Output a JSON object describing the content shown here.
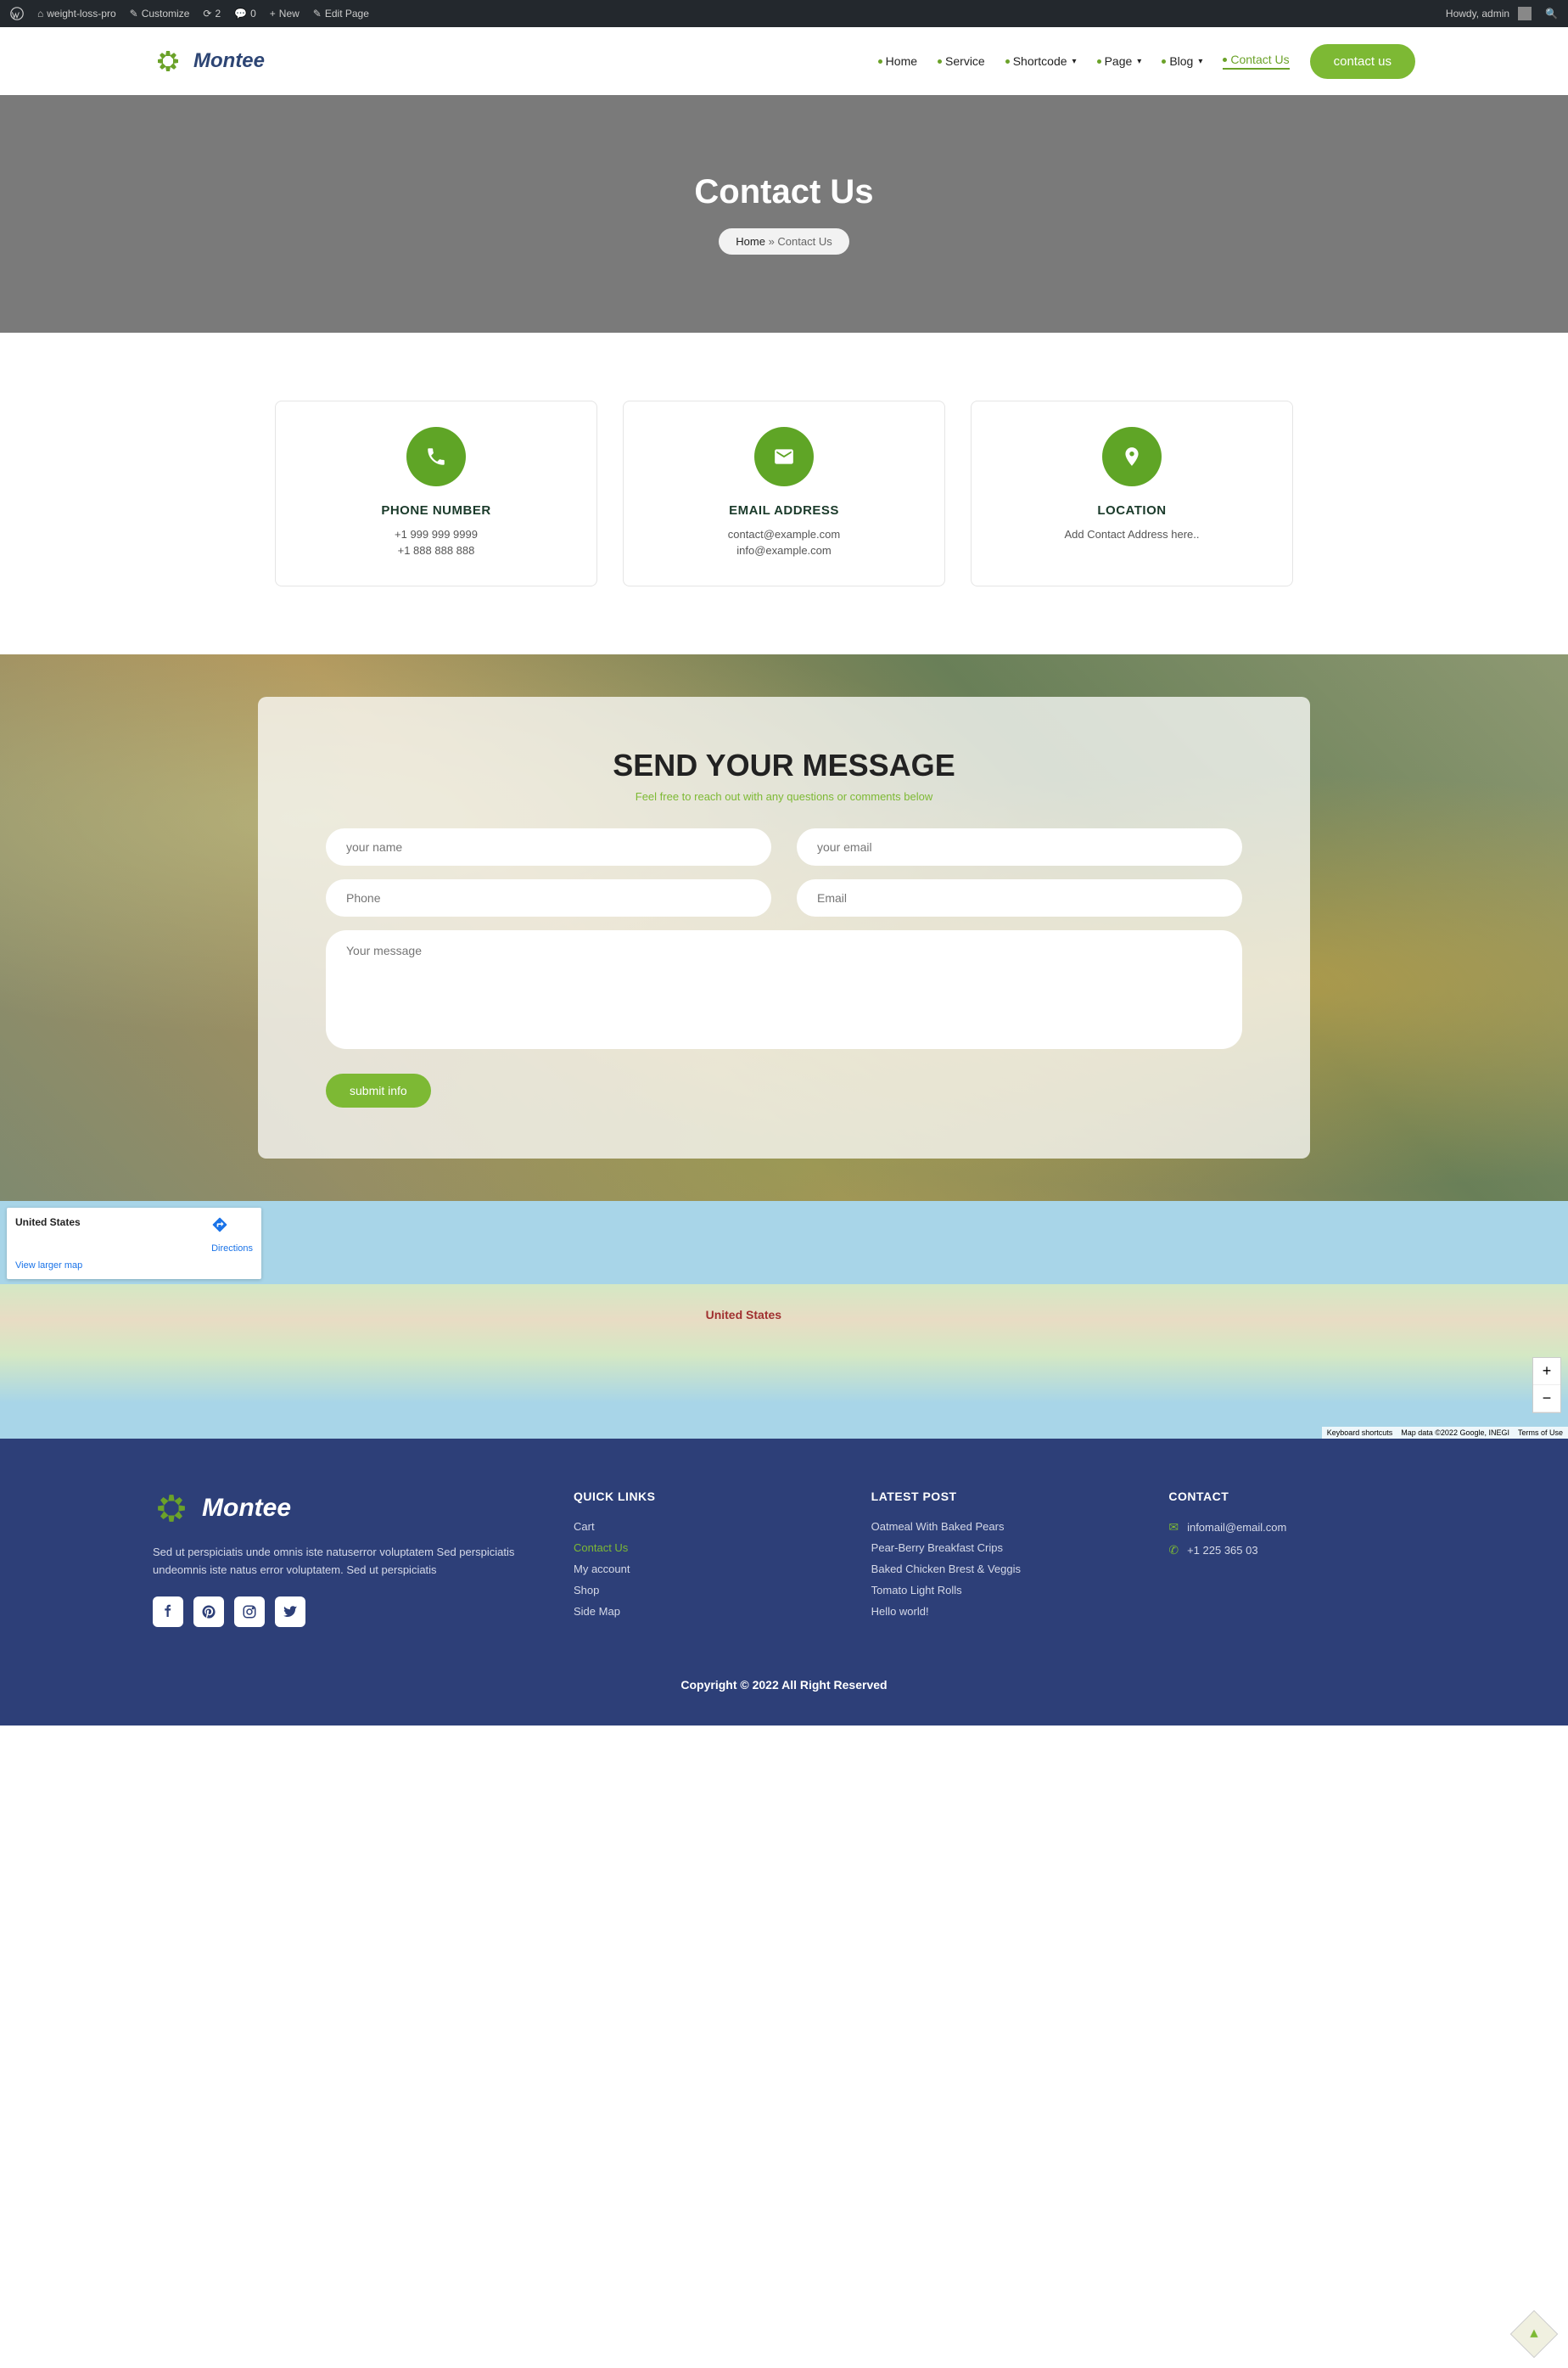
{
  "admin": {
    "site": "weight-loss-pro",
    "customize": "Customize",
    "updates": "2",
    "comments": "0",
    "new": "New",
    "edit": "Edit Page",
    "howdy": "Howdy, admin"
  },
  "brand": "Montee",
  "nav": {
    "home": "Home",
    "service": "Service",
    "shortcode": "Shortcode",
    "page": "Page",
    "blog": "Blog",
    "contact": "Contact Us",
    "contact_btn": "contact us"
  },
  "hero": {
    "title": "Contact Us",
    "home": "Home",
    "sep": "»",
    "current": "Contact Us"
  },
  "cards": {
    "phone": {
      "title": "PHONE NUMBER",
      "l1": "+1 999 999 9999",
      "l2": "+1 888 888 888"
    },
    "email": {
      "title": "EMAIL ADDRESS",
      "l1": "contact@example.com",
      "l2": "info@example.com"
    },
    "location": {
      "title": "LOCATION",
      "l1": "Add Contact Address here.."
    }
  },
  "form": {
    "title": "SEND YOUR MESSAGE",
    "sub": "Feel free to reach out with any questions or comments below",
    "name": "your name",
    "email1": "your email",
    "phone": "Phone",
    "email2": "Email",
    "message": "Your message",
    "submit": "submit info"
  },
  "map": {
    "title": "United States",
    "directions": "Directions",
    "view_larger": "View larger map",
    "center": "United States",
    "footer1": "Keyboard shortcuts",
    "footer2": "Map data ©2022 Google, INEGI",
    "footer3": "Terms of Use"
  },
  "footer": {
    "brand": "Montee",
    "desc": "Sed ut perspiciatis unde omnis iste natuserror voluptatem Sed perspiciatis undeomnis iste natus error voluptatem. Sed ut perspiciatis",
    "quick": {
      "heading": "QUICK LINKS",
      "items": [
        "Cart",
        "Contact Us",
        "My account",
        "Shop",
        "Side Map"
      ]
    },
    "latest": {
      "heading": "LATEST POST",
      "items": [
        "Oatmeal With Baked Pears",
        "Pear-Berry Breakfast Crips",
        "Baked Chicken Brest & Veggis",
        "Tomato Light Rolls",
        "Hello world!"
      ]
    },
    "contact": {
      "heading": "CONTACT",
      "email": "infomail@email.com",
      "phone": "+1 225 365 03"
    },
    "copyright": "Copyright © 2022 All Right Reserved"
  }
}
